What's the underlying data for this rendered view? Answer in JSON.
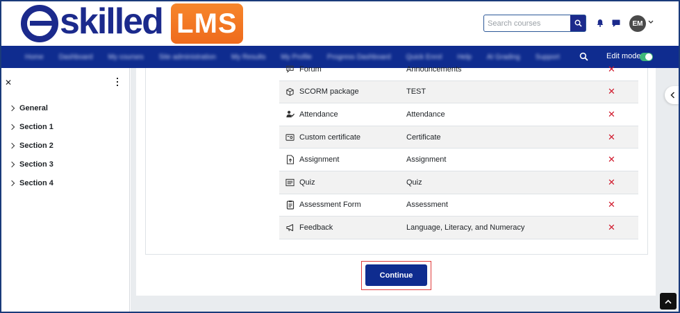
{
  "brand": {
    "wordmark": "skilled",
    "badge": "LMS",
    "primary_color": "#1b2a8c",
    "badge_color": "#f07a22"
  },
  "header": {
    "search": {
      "placeholder": "Search courses"
    },
    "avatar_initials": "EM",
    "icons": [
      "search-icon",
      "bell-icon",
      "chat-icon",
      "chevron-down-icon"
    ]
  },
  "navbar": {
    "items": [
      "Home",
      "Dashboard",
      "My courses",
      "Site administration",
      "My Results",
      "My Profile",
      "Progress Dashboard",
      "Quick Enrol",
      "Help",
      "AI Grading",
      "Support"
    ],
    "edit_mode_label": "Edit mode",
    "edit_mode_on": true
  },
  "drawer": {
    "close_glyph": "✕",
    "sections": [
      "General",
      "Section 1",
      "Section 2",
      "Section 3",
      "Section 4"
    ]
  },
  "activities": [
    {
      "icon": "forum-icon",
      "type": "Forum",
      "name": "Announcements"
    },
    {
      "icon": "scorm-package-icon",
      "type": "SCORM package",
      "name": "TEST"
    },
    {
      "icon": "attendance-icon",
      "type": "Attendance",
      "name": "Attendance"
    },
    {
      "icon": "certificate-icon",
      "type": "Custom certificate",
      "name": "Certificate"
    },
    {
      "icon": "assignment-icon",
      "type": "Assignment",
      "name": "Assignment"
    },
    {
      "icon": "quiz-icon",
      "type": "Quiz",
      "name": "Quiz"
    },
    {
      "icon": "assessment-form-icon",
      "type": "Assessment Form",
      "name": "Assessment"
    },
    {
      "icon": "feedback-icon",
      "type": "Feedback",
      "name": "Language, Literacy, and Numeracy"
    }
  ],
  "delete_glyph": "✕",
  "continue_label": "Continue",
  "highlight_color": "#e03b3b"
}
